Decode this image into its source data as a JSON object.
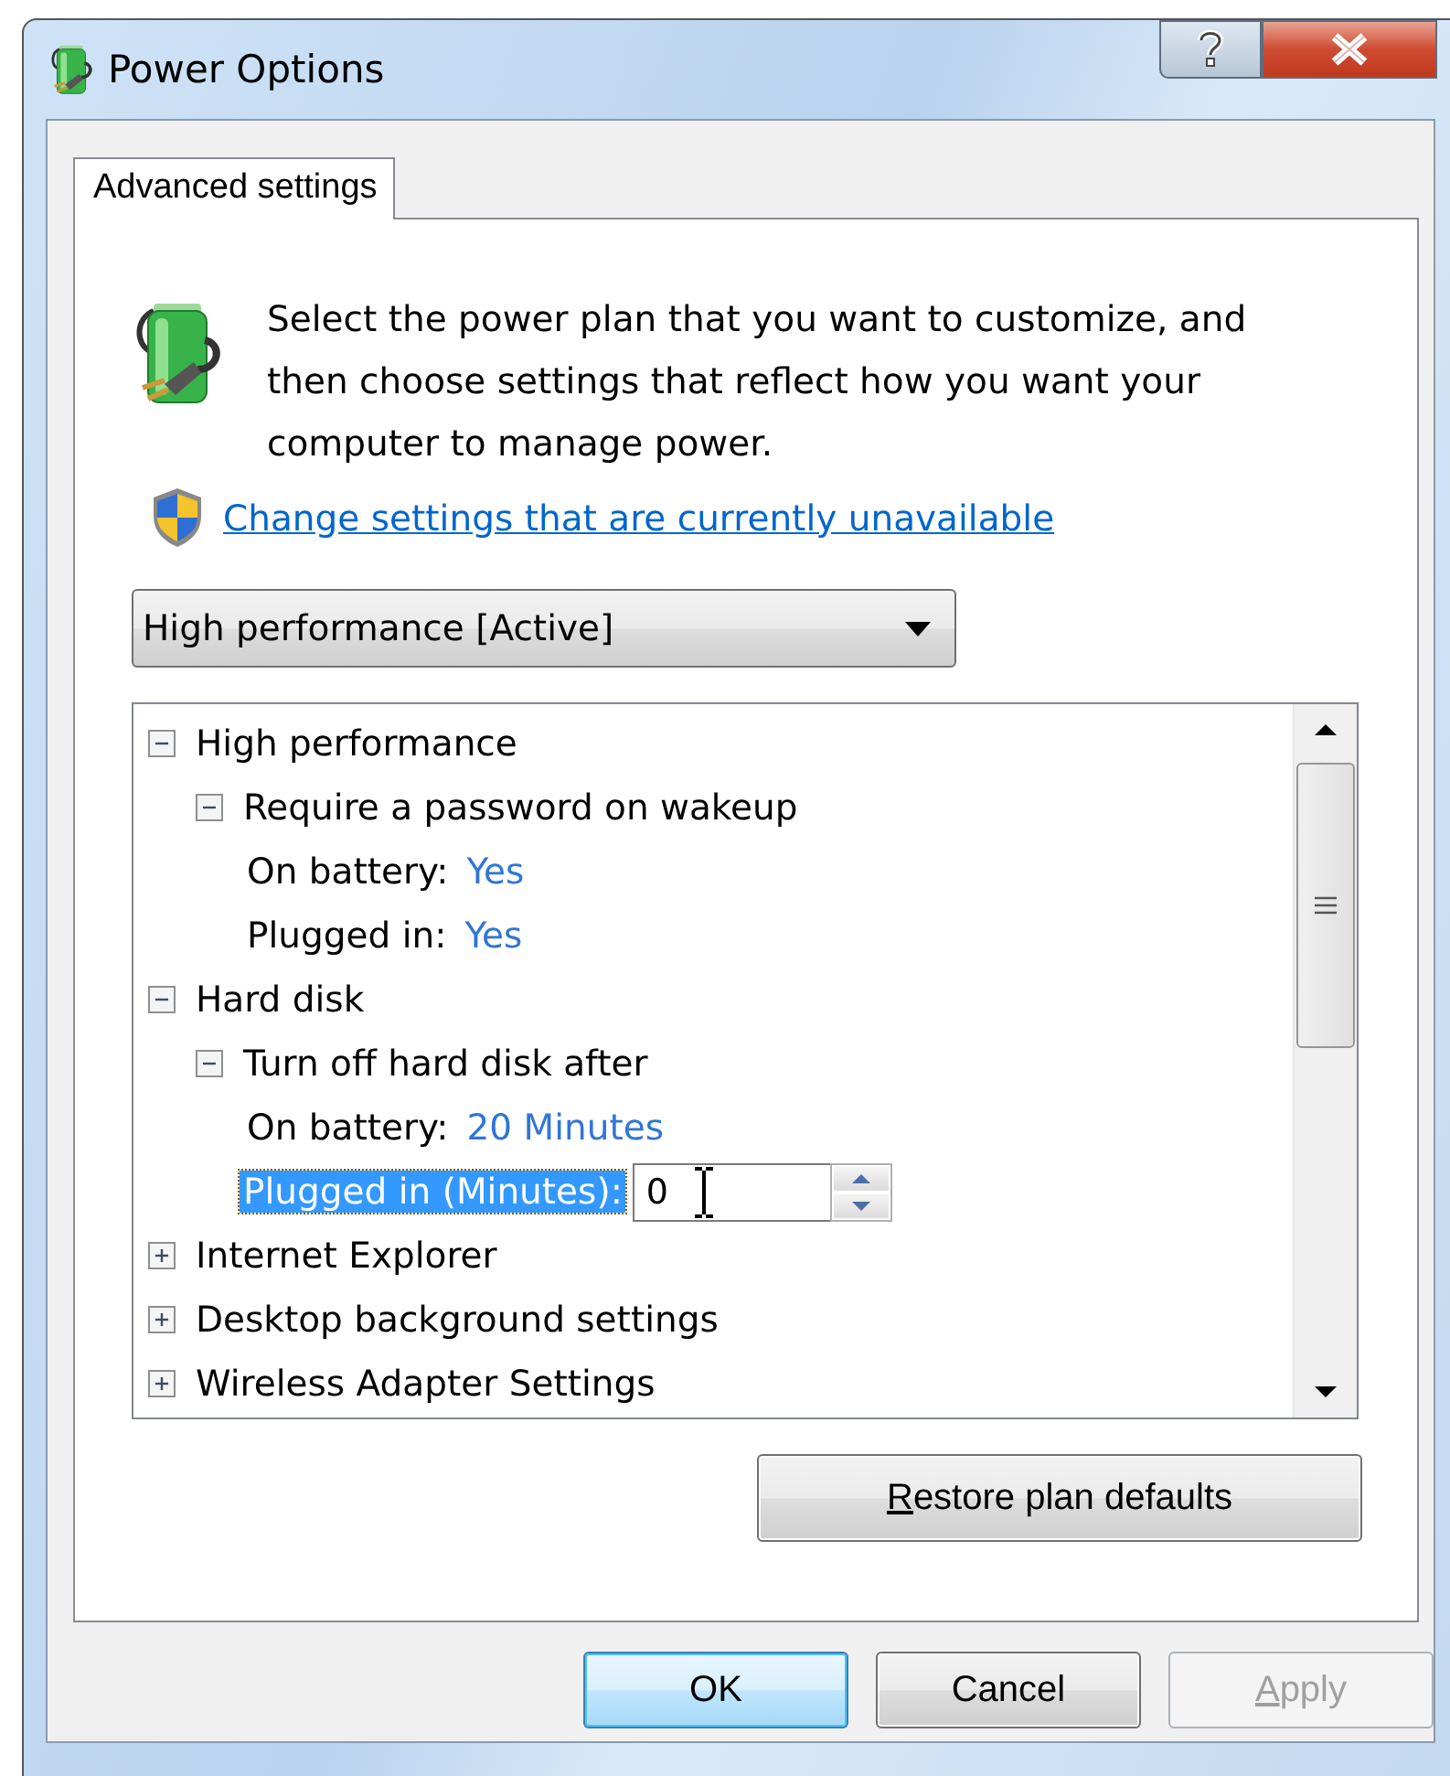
{
  "window": {
    "title": "Power Options"
  },
  "tabs": [
    {
      "label": "Advanced settings",
      "selected": true
    }
  ],
  "description": "Select the power plan that you want to customize, and then choose settings that reflect how you want your computer to manage power.",
  "link": "Change settings that are currently unavailable",
  "plan_dropdown": {
    "value": "High performance [Active]"
  },
  "tree": [
    {
      "kind": "group",
      "label": "High performance",
      "expanded": true,
      "selected": false,
      "children": [
        {
          "kind": "group",
          "label": "Require a password on wakeup",
          "expanded": true,
          "selected": false,
          "children": [
            {
              "kind": "value",
              "label": "On battery:",
              "value": "Yes",
              "selected": false
            },
            {
              "kind": "value",
              "label": "Plugged in:",
              "value": "Yes",
              "selected": false
            }
          ]
        }
      ]
    },
    {
      "kind": "group",
      "label": "Hard disk",
      "expanded": true,
      "selected": false,
      "children": [
        {
          "kind": "group",
          "label": "Turn off hard disk after",
          "expanded": true,
          "selected": false,
          "children": [
            {
              "kind": "value",
              "label": "On battery:",
              "value": "20 Minutes",
              "selected": false
            },
            {
              "kind": "edit",
              "label": "Plugged in (Minutes):",
              "value": "0",
              "selected": true
            }
          ]
        }
      ]
    },
    {
      "kind": "group",
      "label": "Internet Explorer",
      "expanded": false,
      "selected": false
    },
    {
      "kind": "group",
      "label": "Desktop background settings",
      "expanded": false,
      "selected": false
    },
    {
      "kind": "group",
      "label": "Wireless Adapter Settings",
      "expanded": false,
      "selected": false
    }
  ],
  "restore_button": {
    "label": "Restore plan defaults",
    "mnemonic": true,
    "disabled": false
  },
  "buttons": [
    {
      "label": "OK",
      "default": true,
      "disabled": false
    },
    {
      "label": "Cancel",
      "default": false,
      "disabled": false
    },
    {
      "label": "Apply",
      "default": false,
      "disabled": true,
      "mnemonic": true
    }
  ]
}
